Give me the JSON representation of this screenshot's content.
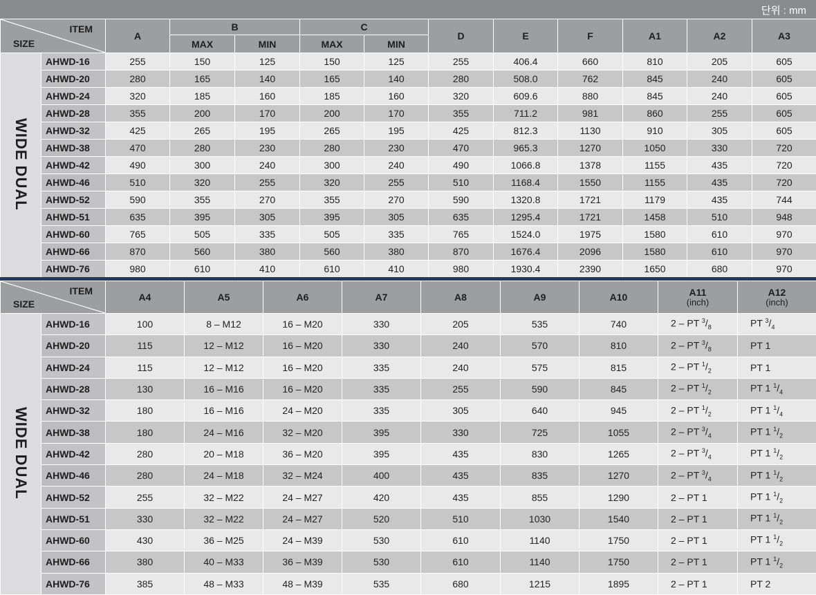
{
  "unit_label": "단위 : mm",
  "side_label": "WIDE DUAL",
  "corner": {
    "item": "ITEM",
    "size": "SIZE"
  },
  "top": {
    "headers": {
      "A": "A",
      "B": "B",
      "C": "C",
      "D": "D",
      "E": "E",
      "F": "F",
      "A1": "A1",
      "A2": "A2",
      "A3": "A3",
      "max": "MAX",
      "min": "MIN"
    },
    "rows": [
      [
        "AHWD-16",
        "255",
        "150",
        "125",
        "150",
        "125",
        "255",
        "406.4",
        "660",
        "810",
        "205",
        "605"
      ],
      [
        "AHWD-20",
        "280",
        "165",
        "140",
        "165",
        "140",
        "280",
        "508.0",
        "762",
        "845",
        "240",
        "605"
      ],
      [
        "AHWD-24",
        "320",
        "185",
        "160",
        "185",
        "160",
        "320",
        "609.6",
        "880",
        "845",
        "240",
        "605"
      ],
      [
        "AHWD-28",
        "355",
        "200",
        "170",
        "200",
        "170",
        "355",
        "711.2",
        "981",
        "860",
        "255",
        "605"
      ],
      [
        "AHWD-32",
        "425",
        "265",
        "195",
        "265",
        "195",
        "425",
        "812.3",
        "1130",
        "910",
        "305",
        "605"
      ],
      [
        "AHWD-38",
        "470",
        "280",
        "230",
        "280",
        "230",
        "470",
        "965.3",
        "1270",
        "1050",
        "330",
        "720"
      ],
      [
        "AHWD-42",
        "490",
        "300",
        "240",
        "300",
        "240",
        "490",
        "1066.8",
        "1378",
        "1155",
        "435",
        "720"
      ],
      [
        "AHWD-46",
        "510",
        "320",
        "255",
        "320",
        "255",
        "510",
        "1168.4",
        "1550",
        "1155",
        "435",
        "720"
      ],
      [
        "AHWD-52",
        "590",
        "355",
        "270",
        "355",
        "270",
        "590",
        "1320.8",
        "1721",
        "1179",
        "435",
        "744"
      ],
      [
        "AHWD-51",
        "635",
        "395",
        "305",
        "395",
        "305",
        "635",
        "1295.4",
        "1721",
        "1458",
        "510",
        "948"
      ],
      [
        "AHWD-60",
        "765",
        "505",
        "335",
        "505",
        "335",
        "765",
        "1524.0",
        "1975",
        "1580",
        "610",
        "970"
      ],
      [
        "AHWD-66",
        "870",
        "560",
        "380",
        "560",
        "380",
        "870",
        "1676.4",
        "2096",
        "1580",
        "610",
        "970"
      ],
      [
        "AHWD-76",
        "980",
        "610",
        "410",
        "610",
        "410",
        "980",
        "1930.4",
        "2390",
        "1650",
        "680",
        "970"
      ]
    ]
  },
  "bottom": {
    "headers": {
      "A4": "A4",
      "A5": "A5",
      "A6": "A6",
      "A7": "A7",
      "A8": "A8",
      "A9": "A9",
      "A10": "A10",
      "A11": "A11",
      "A12": "A12",
      "inch": "(inch)"
    },
    "rows": [
      {
        "size": "AHWD-16",
        "a4": "100",
        "a5": "8 – M12",
        "a6": "16 – M20",
        "a7": "330",
        "a8": "205",
        "a9": "535",
        "a10": "740",
        "a11": {
          "pre": "2 – PT ",
          "int": "",
          "num": "3",
          "den": "8"
        },
        "a12": {
          "pre": "PT ",
          "int": "",
          "num": "3",
          "den": "4"
        }
      },
      {
        "size": "AHWD-20",
        "a4": "115",
        "a5": "12 – M12",
        "a6": "16 – M20",
        "a7": "330",
        "a8": "240",
        "a9": "570",
        "a10": "810",
        "a11": {
          "pre": "2 – PT ",
          "int": "",
          "num": "3",
          "den": "8"
        },
        "a12": {
          "pre": "PT 1",
          "int": "",
          "num": "",
          "den": ""
        }
      },
      {
        "size": "AHWD-24",
        "a4": "115",
        "a5": "12 – M12",
        "a6": "16 – M20",
        "a7": "335",
        "a8": "240",
        "a9": "575",
        "a10": "815",
        "a11": {
          "pre": "2 – PT ",
          "int": "",
          "num": "1",
          "den": "2"
        },
        "a12": {
          "pre": "PT 1",
          "int": "",
          "num": "",
          "den": ""
        }
      },
      {
        "size": "AHWD-28",
        "a4": "130",
        "a5": "16 – M16",
        "a6": "16 – M20",
        "a7": "335",
        "a8": "255",
        "a9": "590",
        "a10": "845",
        "a11": {
          "pre": "2 – PT ",
          "int": "",
          "num": "1",
          "den": "2"
        },
        "a12": {
          "pre": "PT 1 ",
          "int": "",
          "num": "1",
          "den": "4"
        }
      },
      {
        "size": "AHWD-32",
        "a4": "180",
        "a5": "16 – M16",
        "a6": "24 – M20",
        "a7": "335",
        "a8": "305",
        "a9": "640",
        "a10": "945",
        "a11": {
          "pre": "2 – PT ",
          "int": "",
          "num": "1",
          "den": "2"
        },
        "a12": {
          "pre": "PT 1 ",
          "int": "",
          "num": "1",
          "den": "4"
        }
      },
      {
        "size": "AHWD-38",
        "a4": "180",
        "a5": "24 – M16",
        "a6": "32 – M20",
        "a7": "395",
        "a8": "330",
        "a9": "725",
        "a10": "1055",
        "a11": {
          "pre": "2 – PT ",
          "int": "",
          "num": "3",
          "den": "4"
        },
        "a12": {
          "pre": "PT 1 ",
          "int": "",
          "num": "1",
          "den": "2"
        }
      },
      {
        "size": "AHWD-42",
        "a4": "280",
        "a5": "20 – M18",
        "a6": "36 – M20",
        "a7": "395",
        "a8": "435",
        "a9": "830",
        "a10": "1265",
        "a11": {
          "pre": "2 – PT ",
          "int": "",
          "num": "3",
          "den": "4"
        },
        "a12": {
          "pre": "PT 1 ",
          "int": "",
          "num": "1",
          "den": "2"
        }
      },
      {
        "size": "AHWD-46",
        "a4": "280",
        "a5": "24 – M18",
        "a6": "32 – M24",
        "a7": "400",
        "a8": "435",
        "a9": "835",
        "a10": "1270",
        "a11": {
          "pre": "2 – PT ",
          "int": "",
          "num": "3",
          "den": "4"
        },
        "a12": {
          "pre": "PT 1 ",
          "int": "",
          "num": "1",
          "den": "2"
        }
      },
      {
        "size": "AHWD-52",
        "a4": "255",
        "a5": "32 – M22",
        "a6": "24 – M27",
        "a7": "420",
        "a8": "435",
        "a9": "855",
        "a10": "1290",
        "a11": {
          "pre": "2 – PT 1",
          "int": "",
          "num": "",
          "den": ""
        },
        "a12": {
          "pre": "PT 1 ",
          "int": "",
          "num": "1",
          "den": "2"
        }
      },
      {
        "size": "AHWD-51",
        "a4": "330",
        "a5": "32 – M22",
        "a6": "24 – M27",
        "a7": "520",
        "a8": "510",
        "a9": "1030",
        "a10": "1540",
        "a11": {
          "pre": "2 – PT 1",
          "int": "",
          "num": "",
          "den": ""
        },
        "a12": {
          "pre": "PT 1 ",
          "int": "",
          "num": "1",
          "den": "2"
        }
      },
      {
        "size": "AHWD-60",
        "a4": "430",
        "a5": "36 – M25",
        "a6": "24 – M39",
        "a7": "530",
        "a8": "610",
        "a9": "1140",
        "a10": "1750",
        "a11": {
          "pre": "2 – PT 1",
          "int": "",
          "num": "",
          "den": ""
        },
        "a12": {
          "pre": "PT 1 ",
          "int": "",
          "num": "1",
          "den": "2"
        }
      },
      {
        "size": "AHWD-66",
        "a4": "380",
        "a5": "40 – M33",
        "a6": "36 – M39",
        "a7": "530",
        "a8": "610",
        "a9": "1140",
        "a10": "1750",
        "a11": {
          "pre": "2 – PT 1",
          "int": "",
          "num": "",
          "den": ""
        },
        "a12": {
          "pre": "PT 1 ",
          "int": "",
          "num": "1",
          "den": "2"
        }
      },
      {
        "size": "AHWD-76",
        "a4": "385",
        "a5": "48 – M33",
        "a6": "48 – M39",
        "a7": "535",
        "a8": "680",
        "a9": "1215",
        "a10": "1895",
        "a11": {
          "pre": "2 – PT 1",
          "int": "",
          "num": "",
          "den": ""
        },
        "a12": {
          "pre": "PT 2",
          "int": "",
          "num": "",
          "den": ""
        }
      }
    ]
  },
  "colors": {
    "header": "#9d9ea0",
    "row_light": "#e9e9ea",
    "row_dark": "#c7c7c8",
    "divider": "#1f3a5c"
  }
}
